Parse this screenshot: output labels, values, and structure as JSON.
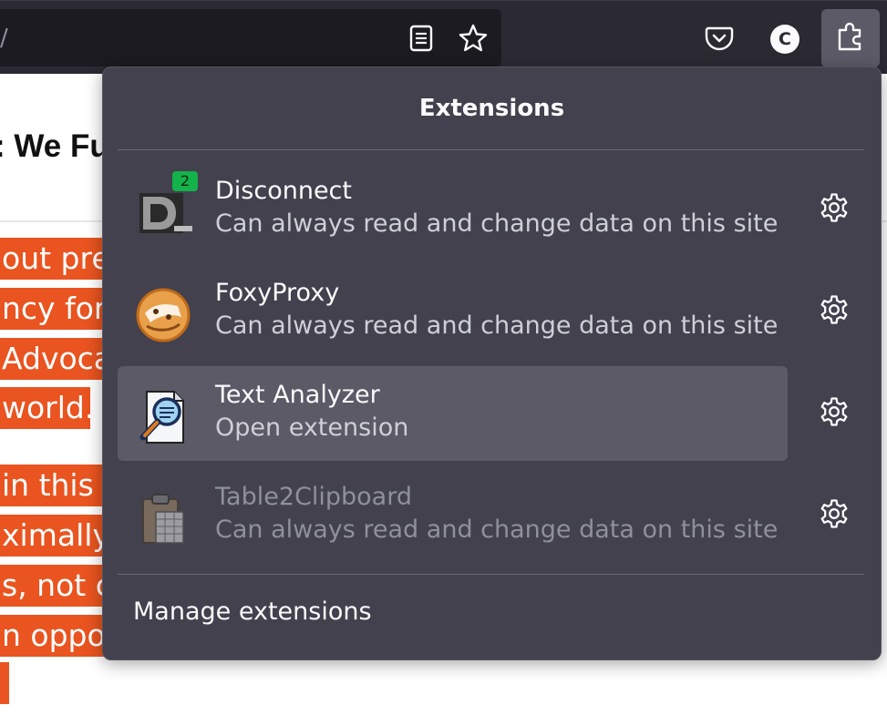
{
  "toolbar": {
    "url_fragment": "/",
    "reader_icon": "reader-view-icon",
    "star_icon": "bookmark-star-icon",
    "pocket_icon": "pocket-icon",
    "account_initial": "C",
    "extensions_icon": "puzzle-piece-icon"
  },
  "page": {
    "heading": ": We Fu",
    "highlight_lines": [
      "out prev",
      "ncy for t",
      "Advocac",
      "world.",
      "in this r",
      "ximally",
      "s, not c",
      "n opport",
      ""
    ],
    "highlight_color": "#e95420"
  },
  "panel": {
    "title": "Extensions",
    "extensions": [
      {
        "name": "Disconnect",
        "description": "Can always read and change data on this site",
        "badge": "2",
        "icon": "disconnect-logo-icon",
        "enabled": true
      },
      {
        "name": "FoxyProxy",
        "description": "Can always read and change data on this site",
        "icon": "foxyproxy-logo-icon",
        "enabled": true
      },
      {
        "name": "Text Analyzer",
        "description": "Open extension",
        "icon": "text-analyzer-magnifier-icon",
        "enabled": true
      },
      {
        "name": "Table2Clipboard",
        "description": "Can always read and change data on this site",
        "icon": "clipboard-table-icon",
        "enabled": false
      }
    ],
    "manage_label": "Manage extensions"
  },
  "colors": {
    "toolbar_bg": "#2b2a33",
    "panel_bg": "#42414d",
    "hover_row_bg": "#5b5a66",
    "badge_bg": "#13b24a"
  }
}
